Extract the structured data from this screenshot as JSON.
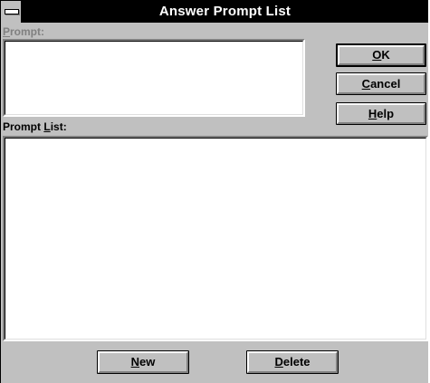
{
  "window": {
    "title": "Answer Prompt List"
  },
  "prompt": {
    "label_mnemonic": "P",
    "label_rest": "rompt:",
    "value": ""
  },
  "prompt_list": {
    "label_before": "Prompt ",
    "label_mnemonic": "L",
    "label_after": "ist:",
    "items": []
  },
  "buttons": {
    "ok": {
      "mnemonic": "O",
      "rest": "K"
    },
    "cancel": {
      "mnemonic": "C",
      "rest": "ancel"
    },
    "help": {
      "mnemonic": "H",
      "rest": "elp"
    },
    "new": {
      "mnemonic": "N",
      "rest": "ew"
    },
    "delete": {
      "mnemonic": "D",
      "rest": "elete"
    }
  }
}
